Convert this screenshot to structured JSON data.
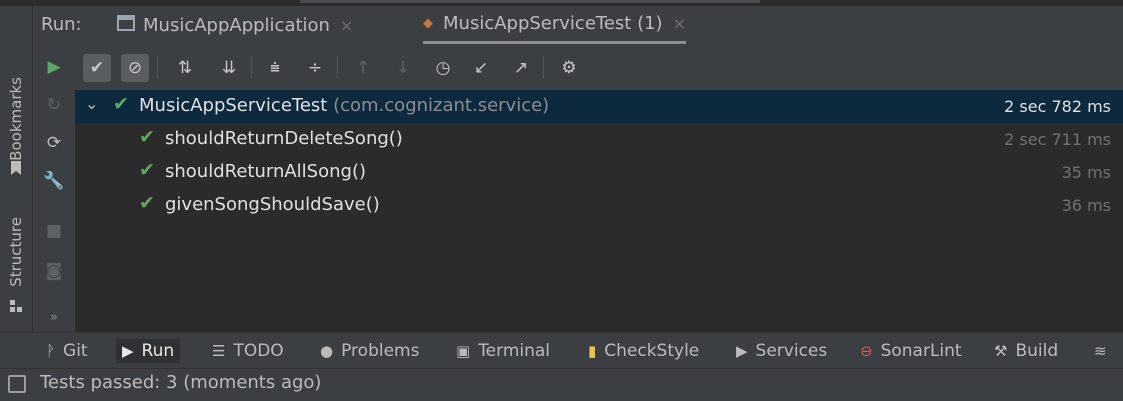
{
  "run_label": "Run:",
  "tabs": [
    {
      "icon": "window-icon",
      "label": "MusicAppApplication",
      "close": "×"
    },
    {
      "icon": "test-run-icon",
      "label": "MusicAppServiceTest (1)",
      "close": "×"
    }
  ],
  "side_tabs": {
    "bookmarks": "Bookmarks",
    "structure": "Structure"
  },
  "tree": {
    "root": {
      "name": "MusicAppServiceTest",
      "pkg": "(com.cognizant.service)",
      "time": "2 sec 782 ms"
    },
    "tests": [
      {
        "name": "shouldReturnDeleteSong()",
        "time": "2 sec 711 ms"
      },
      {
        "name": "shouldReturnAllSong()",
        "time": "35 ms"
      },
      {
        "name": "givenSongShouldSave()",
        "time": "36 ms"
      }
    ]
  },
  "bottom_tools": [
    {
      "icon": "git-icon",
      "label": "Git"
    },
    {
      "icon": "run-icon",
      "label": "Run"
    },
    {
      "icon": "todo-icon",
      "label": "TODO"
    },
    {
      "icon": "problems-icon",
      "label": "Problems"
    },
    {
      "icon": "terminal-icon",
      "label": "Terminal"
    },
    {
      "icon": "checkstyle-icon",
      "label": "CheckStyle"
    },
    {
      "icon": "services-icon",
      "label": "Services"
    },
    {
      "icon": "sonarlint-icon",
      "label": "SonarLint"
    },
    {
      "icon": "build-icon",
      "label": "Build"
    }
  ],
  "status": "Tests passed: 3 (moments ago)",
  "colors": {
    "pass": "#5fa85c",
    "selection": "#0d293e",
    "panel": "#3c3f41",
    "tree_bg": "#2b2b2b"
  }
}
